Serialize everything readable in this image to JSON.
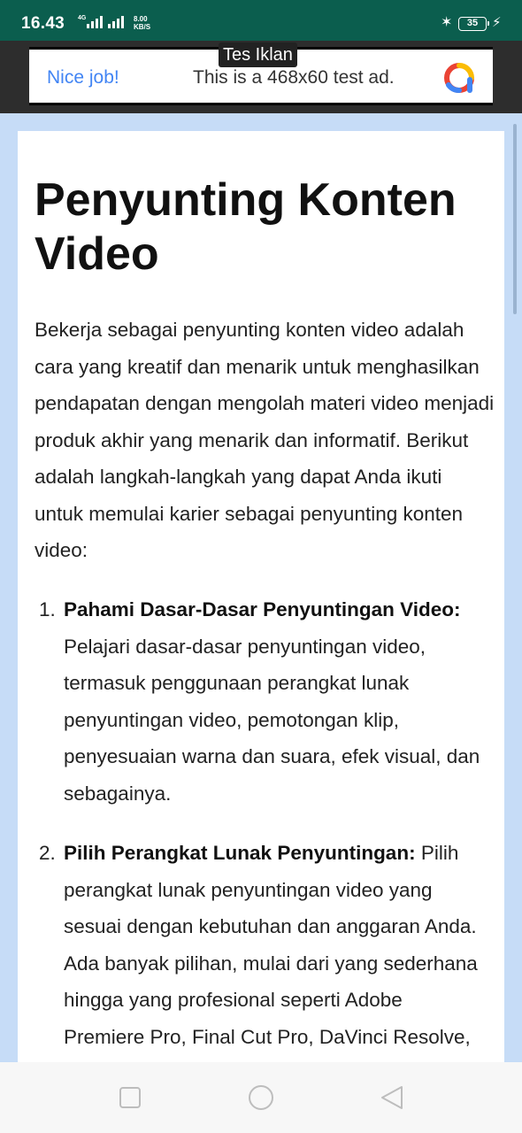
{
  "status": {
    "time": "16.43",
    "network": "4G",
    "speed_value": "8.00",
    "speed_unit": "KB/S",
    "battery": "35"
  },
  "ad": {
    "tag": "Tes Iklan",
    "nice": "Nice job!",
    "text": "This is a 468x60 test ad."
  },
  "article": {
    "title": "Penyunting Konten Video",
    "intro": "Bekerja sebagai penyunting konten video adalah cara yang kreatif dan menarik untuk menghasilkan pendapatan dengan mengolah materi video menjadi produk akhir yang menarik dan informatif. Berikut adalah langkah-langkah yang dapat Anda ikuti untuk memulai karier sebagai penyunting konten video:",
    "steps": [
      {
        "number": "1.",
        "heading": "Pahami Dasar-Dasar Penyuntingan Video:",
        "text": " Pelajari dasar-dasar penyuntingan video, termasuk penggunaan perangkat lunak penyuntingan video, pemotongan klip, penyesuaian warna dan suara, efek visual, dan sebagainya."
      },
      {
        "number": "2.",
        "heading": "Pilih Perangkat Lunak Penyuntingan:",
        "text": " Pilih perangkat lunak penyuntingan video yang sesuai dengan kebutuhan dan anggaran Anda. Ada banyak pilihan, mulai dari yang sederhana hingga yang profesional seperti Adobe Premiere Pro, Final Cut Pro, DaVinci Resolve, dan lain-lain."
      }
    ]
  },
  "colors": {
    "status_bar": "#0b5e4e",
    "page_bg": "#c6dcf7",
    "ad_link": "#4285f4"
  },
  "icons": {
    "recents": "square-icon",
    "home": "circle-icon",
    "back": "triangle-back-icon"
  }
}
